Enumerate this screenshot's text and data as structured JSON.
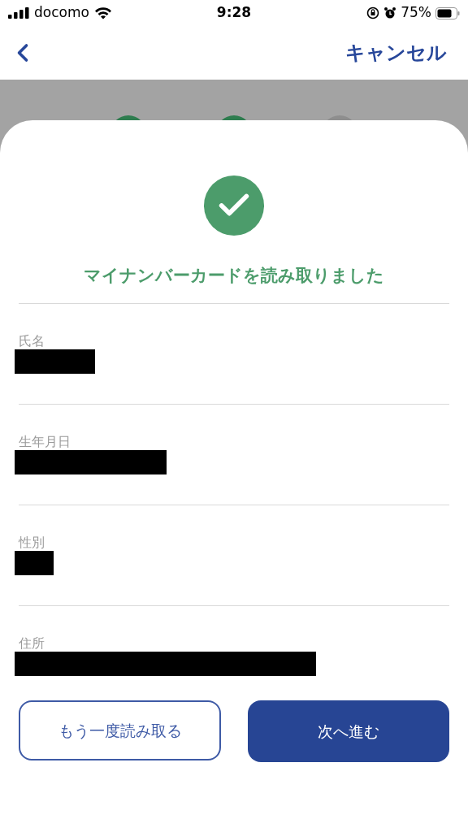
{
  "status_bar": {
    "carrier": "docomo",
    "time": "9:28",
    "battery": "75%"
  },
  "nav": {
    "cancel": "キャンセル"
  },
  "steps": [
    {
      "done": true
    },
    {
      "done": true
    },
    {
      "done": false
    }
  ],
  "result": {
    "title": "マイナンバーカードを読み取りました"
  },
  "fields": [
    {
      "label": "氏名"
    },
    {
      "label": "生年月日"
    },
    {
      "label": "性別"
    },
    {
      "label": "住所"
    }
  ],
  "buttons": {
    "retry": "もう一度読み取る",
    "next": "次へ進む"
  }
}
